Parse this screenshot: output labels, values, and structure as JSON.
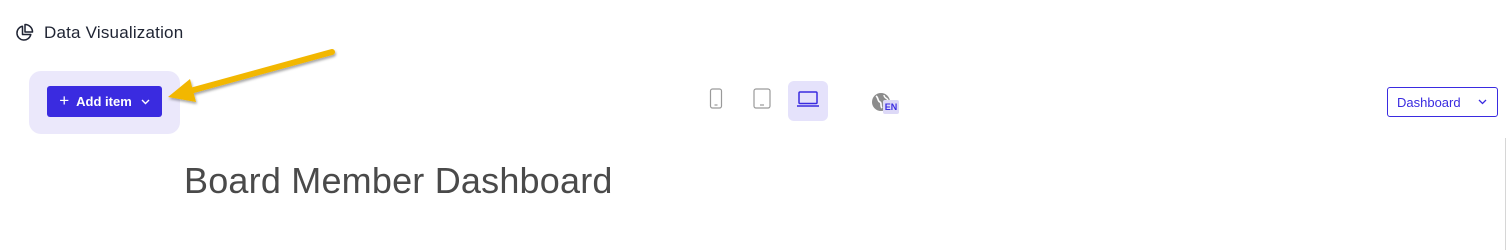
{
  "app": {
    "title": "Data Visualization",
    "icon": "pie-chart-icon"
  },
  "toolbar": {
    "add_item_label": "Add item",
    "devices": [
      {
        "name": "mobile",
        "icon": "smartphone-icon",
        "active": false
      },
      {
        "name": "tablet",
        "icon": "tablet-icon",
        "active": false
      },
      {
        "name": "desktop",
        "icon": "laptop-icon",
        "active": true
      }
    ],
    "language_code": "EN",
    "view_select_value": "Dashboard"
  },
  "dashboard": {
    "title": "Board Member Dashboard"
  },
  "colors": {
    "accent": "#3a2be0",
    "highlight": "#ebe8fb",
    "active_device_bg": "#e5e2fb",
    "arrow": "#f2b705",
    "title_text": "#4a4a4a"
  }
}
